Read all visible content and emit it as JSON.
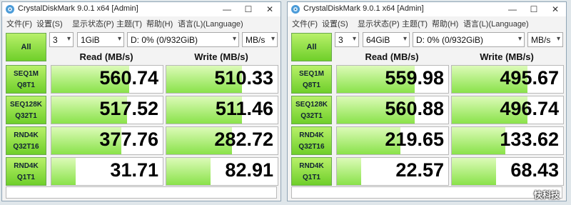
{
  "watermark": "快科技",
  "colors": {
    "accent_green": "#6fcf2a",
    "bar_fill": "#8ae24a"
  },
  "windows": [
    {
      "title": "CrystalDiskMark 9.0.1 x64 [Admin]",
      "menu": [
        "文件(F)",
        "设置(S)",
        "显示状态(P)",
        "主题(T)",
        "帮助(H)",
        "语言(L)(Language)"
      ],
      "all_label": "All",
      "count": "3",
      "size": "1GiB",
      "drive": "D: 0% (0/932GiB)",
      "unit": "MB/s",
      "read_header": "Read (MB/s)",
      "write_header": "Write (MB/s)",
      "comment": "",
      "tests": [
        {
          "l1": "SEQ1M",
          "l2": "Q8T1",
          "read": "560.74",
          "write": "510.33",
          "read_fill": 0.7,
          "write_fill": 0.68
        },
        {
          "l1": "SEQ128K",
          "l2": "Q32T1",
          "read": "517.52",
          "write": "511.46",
          "read_fill": 0.68,
          "write_fill": 0.68
        },
        {
          "l1": "RND4K",
          "l2": "Q32T16",
          "read": "377.76",
          "write": "282.72",
          "read_fill": 0.63,
          "write_fill": 0.59
        },
        {
          "l1": "RND4K",
          "l2": "Q1T1",
          "read": "31.71",
          "write": "82.91",
          "read_fill": 0.22,
          "write_fill": 0.4
        }
      ]
    },
    {
      "title": "CrystalDiskMark 9.0.1 x64 [Admin]",
      "menu": [
        "文件(F)",
        "设置(S)",
        "显示状态(P)",
        "主题(T)",
        "帮助(H)",
        "语言(L)(Language)"
      ],
      "all_label": "All",
      "count": "3",
      "size": "64GiB",
      "drive": "D: 0% (0/932GiB)",
      "unit": "MB/s",
      "read_header": "Read (MB/s)",
      "write_header": "Write (MB/s)",
      "comment": "",
      "tests": [
        {
          "l1": "SEQ1M",
          "l2": "Q8T1",
          "read": "559.98",
          "write": "495.67",
          "read_fill": 0.7,
          "write_fill": 0.68
        },
        {
          "l1": "SEQ128K",
          "l2": "Q32T1",
          "read": "560.88",
          "write": "496.74",
          "read_fill": 0.7,
          "write_fill": 0.68
        },
        {
          "l1": "RND4K",
          "l2": "Q32T16",
          "read": "219.65",
          "write": "133.62",
          "read_fill": 0.57,
          "write_fill": 0.48
        },
        {
          "l1": "RND4K",
          "l2": "Q1T1",
          "read": "22.57",
          "write": "68.43",
          "read_fill": 0.22,
          "write_fill": 0.4
        }
      ]
    }
  ]
}
